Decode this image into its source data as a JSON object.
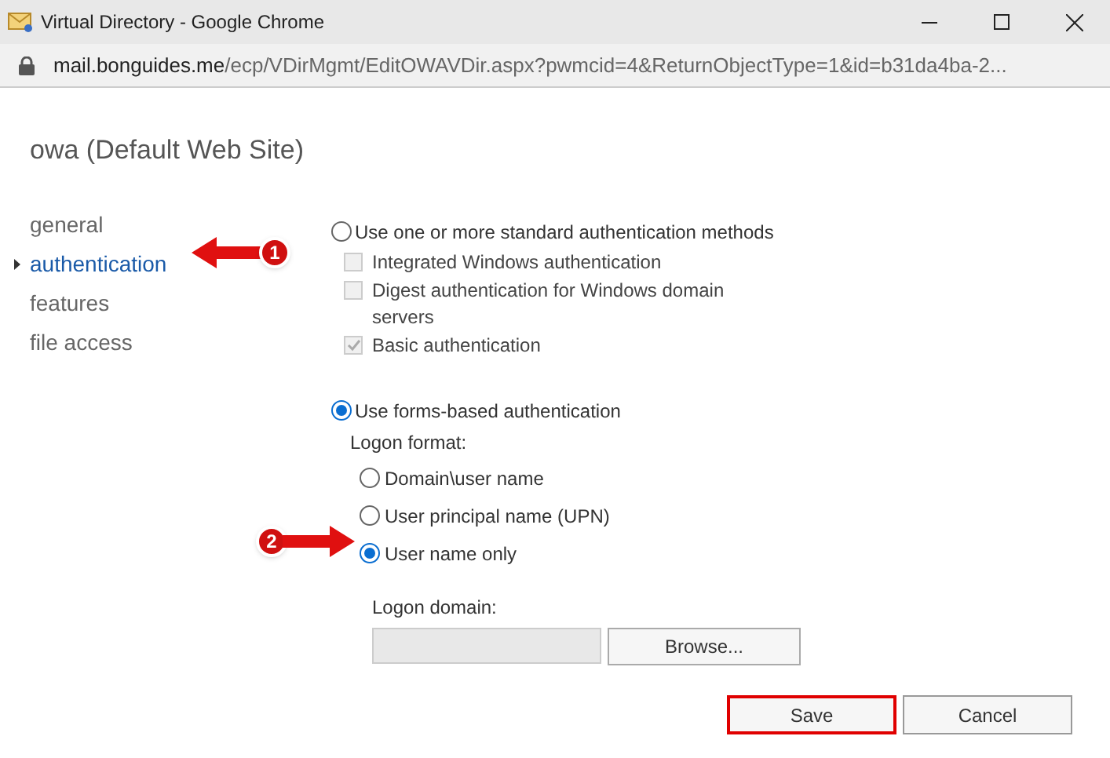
{
  "window": {
    "title": "Virtual Directory - Google Chrome"
  },
  "address": {
    "host": "mail.bonguides.me",
    "path": "/ecp/VDirMgmt/EditOWAVDir.aspx?pwmcid=4&ReturnObjectType=1&id=b31da4ba-2..."
  },
  "heading": "owa (Default Web Site)",
  "nav": [
    {
      "label": "general",
      "selected": false
    },
    {
      "label": "authentication",
      "selected": true
    },
    {
      "label": "features",
      "selected": false
    },
    {
      "label": "file access",
      "selected": false
    }
  ],
  "methods": [
    {
      "label": "Use one or more standard authentication methods",
      "selected": false,
      "options": [
        {
          "label": "Integrated Windows authentication",
          "checked": false,
          "disabled": true
        },
        {
          "label": "Digest authentication for Windows domain servers",
          "checked": false,
          "disabled": true
        },
        {
          "label": "Basic authentication",
          "checked": true,
          "disabled": true
        }
      ]
    },
    {
      "label": "Use forms-based authentication",
      "selected": true,
      "format_label": "Logon format:",
      "formats": [
        {
          "label": "Domain\\user name",
          "selected": false
        },
        {
          "label": "User principal name (UPN)",
          "selected": false
        },
        {
          "label": "User name only",
          "selected": true
        }
      ],
      "domain_label": "Logon domain:",
      "browse": "Browse..."
    }
  ],
  "buttons": [
    {
      "label": "Save",
      "highlighted": true
    },
    {
      "label": "Cancel",
      "highlighted": false
    }
  ],
  "callouts": [
    {
      "number": "1"
    },
    {
      "number": "2"
    }
  ]
}
